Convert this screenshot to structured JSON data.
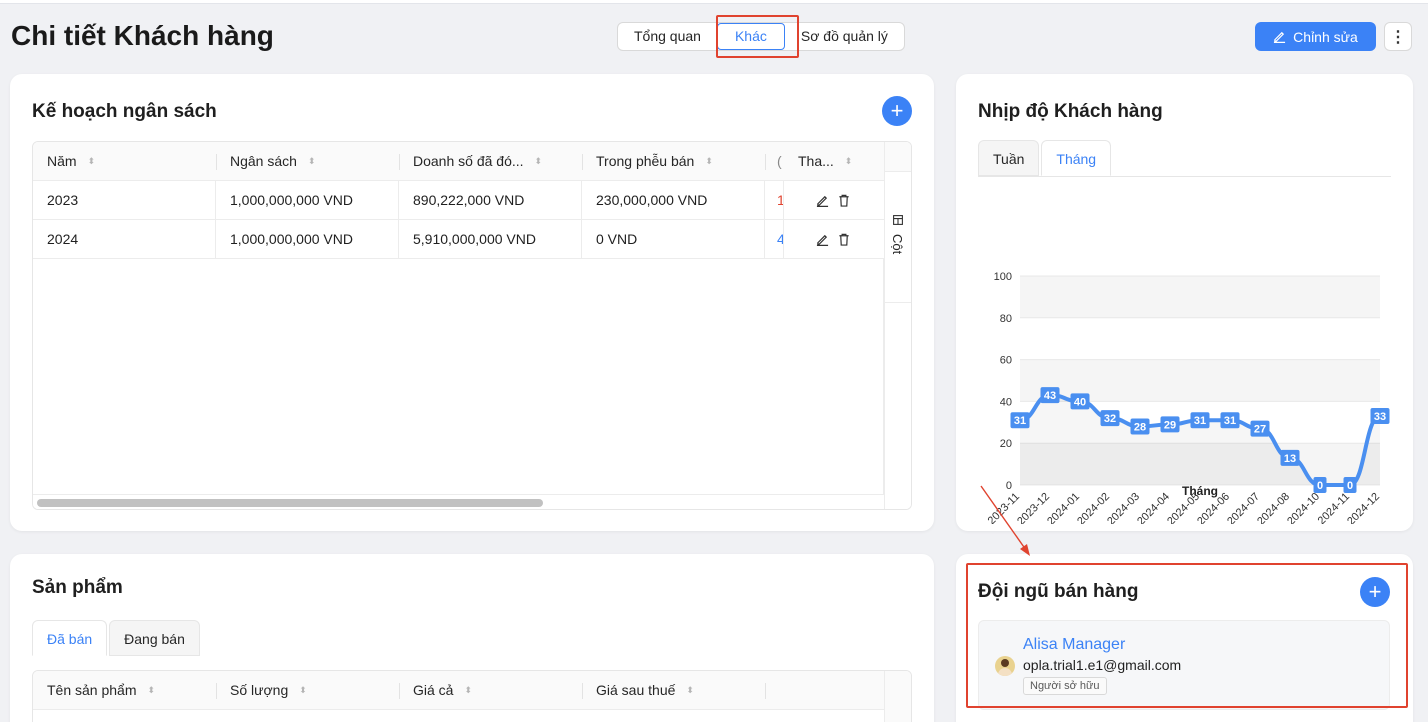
{
  "page": {
    "title": "Chi tiết Khách hàng"
  },
  "header": {
    "segments": [
      {
        "label": "Tổng quan",
        "active": false
      },
      {
        "label": "Khác",
        "active": true
      },
      {
        "label": "Sơ đồ quản lý",
        "active": false
      }
    ],
    "edit_label": "Chỉnh sửa",
    "more_label": "⋮"
  },
  "budget": {
    "title": "Kế hoạch ngân sách",
    "add_label": "+",
    "columns": [
      "Năm",
      "Ngân sách",
      "Doanh số đã đó...",
      "Trong phễu bán",
      "(",
      "Tha..."
    ],
    "rows": [
      {
        "year": "2023",
        "budget": "1,000,000,000 VND",
        "sales": "890,222,000 VND",
        "funnel": "230,000,000 VND",
        "clip": "1"
      },
      {
        "year": "2024",
        "budget": "1,000,000,000 VND",
        "sales": "5,910,000,000 VND",
        "funnel": "0 VND",
        "clip": "4"
      }
    ],
    "columns_toggle_label": "Cột"
  },
  "pace": {
    "title": "Nhịp độ Khách hàng",
    "tabs": [
      {
        "label": "Tuần",
        "active": false
      },
      {
        "label": "Tháng",
        "active": true
      }
    ]
  },
  "chart_data": {
    "type": "line",
    "x": [
      "2023-11",
      "2023-12",
      "2024-01",
      "2024-02",
      "2024-03",
      "2024-04",
      "2024-05",
      "2024-06",
      "2024-07",
      "2024-08",
      "2024-10",
      "2024-11",
      "2024-12"
    ],
    "series": [
      {
        "values": [
          31,
          43,
          40,
          32,
          28,
          29,
          31,
          31,
          27,
          13,
          0,
          0,
          33
        ]
      }
    ],
    "xlabel": "Tháng",
    "ylabel": "",
    "ylim": [
      0,
      100
    ],
    "yticks": [
      0,
      20,
      40,
      60,
      80,
      100
    ],
    "grid": true,
    "color": "#4a8ff0"
  },
  "products": {
    "title": "Sản phẩm",
    "tabs": [
      {
        "label": "Đã bán",
        "active": true
      },
      {
        "label": "Đang bán",
        "active": false
      }
    ],
    "columns": [
      "Tên sản phẩm",
      "Số lượng",
      "Giá cả",
      "Giá sau thuế"
    ]
  },
  "team": {
    "title": "Đội ngũ bán hàng",
    "add_label": "+",
    "members": [
      {
        "name": "Alisa Manager",
        "email": "opla.trial1.e1@gmail.com",
        "role": "Người sở hữu"
      }
    ]
  },
  "colors": {
    "accent": "#3b82f6",
    "highlight": "#e0432f"
  }
}
